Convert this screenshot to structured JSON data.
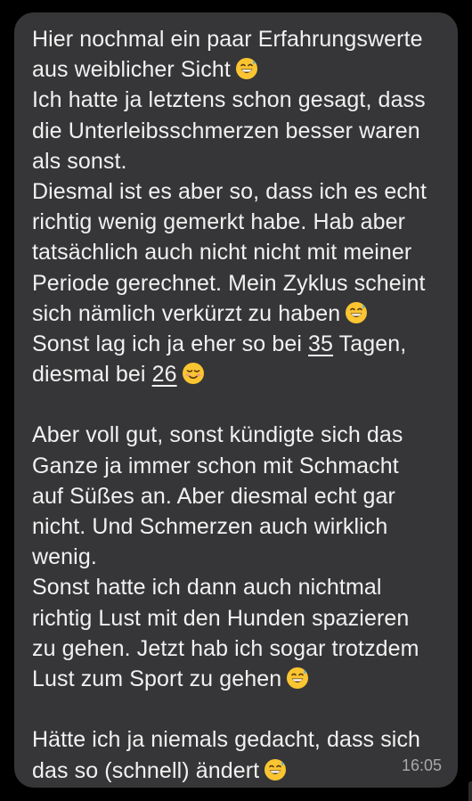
{
  "message": {
    "timestamp": "16:05",
    "lines": {
      "l1": "Hier nochmal ein paar Erfahrungswerte",
      "l2": "aus weiblicher Sicht",
      "l3": "Ich hatte ja letztens schon gesagt, dass",
      "l4": "die Unterleibsschmerzen besser waren",
      "l5": "als sonst.",
      "l6": "Diesmal ist es aber so, dass ich es echt",
      "l7": "richtig wenig gemerkt habe. Hab aber",
      "l8": "tatsächlich auch nicht nicht mit meiner",
      "l9": "Periode gerechnet. Mein Zyklus scheint",
      "l10": "sich nämlich verkürzt zu haben",
      "l11a": "Sonst lag ich ja eher so bei ",
      "l11b": "35",
      "l11c": " Tagen,",
      "l12a": "diesmal bei ",
      "l12b": "26",
      "l13": "Aber voll gut, sonst kündigte sich das",
      "l14": "Ganze ja immer schon mit Schmacht",
      "l15": "auf Süßes an. Aber diesmal echt gar",
      "l16": "nicht. Und Schmerzen auch wirklich",
      "l17": "wenig.",
      "l18": "Sonst hatte ich dann auch nichtmal",
      "l19": "richtig Lust mit den Hunden spazieren",
      "l20": "zu gehen. Jetzt hab ich sogar trotzdem",
      "l21": "Lust zum Sport zu gehen",
      "l22": "Hätte ich ja niemals gedacht, dass sich",
      "l23": "das so (schnell) ändert"
    },
    "emojis": {
      "sweat_smile": "grinning-face-with-sweat-icon",
      "smiling": "smiling-face-icon"
    }
  },
  "colors": {
    "background": "#000000",
    "bubble": "#363638",
    "text": "#f1f1f1",
    "timestamp": "#a9a9ab",
    "emoji_face": "#fbc531"
  }
}
